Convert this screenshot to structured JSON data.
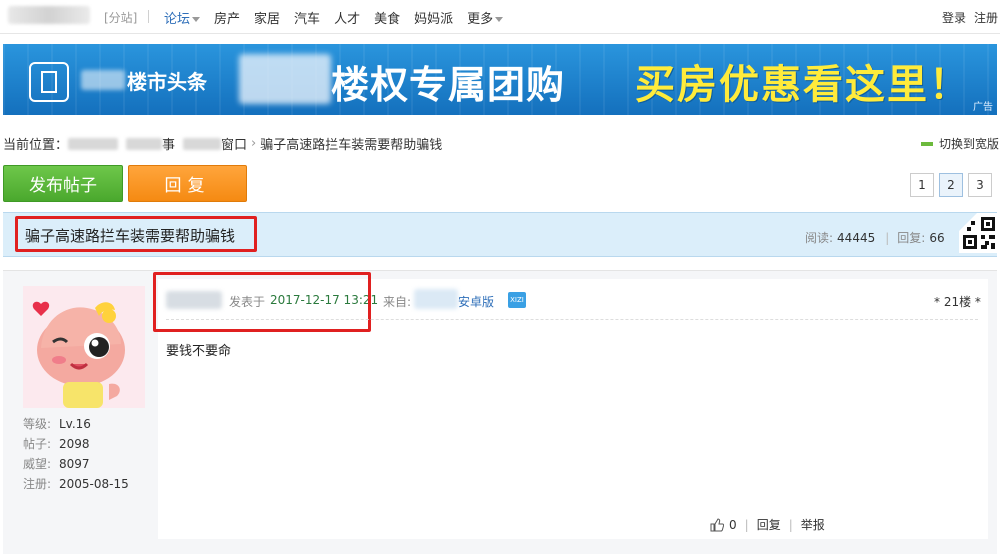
{
  "topnav": {
    "fenzhan": "[分站]",
    "items": [
      {
        "label": "论坛",
        "dropdown": true,
        "active": true
      },
      {
        "label": "房产"
      },
      {
        "label": "家居"
      },
      {
        "label": "汽车"
      },
      {
        "label": "人才"
      },
      {
        "label": "美食"
      },
      {
        "label": "妈妈派"
      },
      {
        "label": "更多",
        "dropdown": true
      }
    ],
    "login": "登录",
    "register": "注册"
  },
  "banner": {
    "brand": "楼市头条",
    "slogan": "楼权专属团购",
    "promo": "买房优惠看这里！",
    "ad_tag": "广告"
  },
  "breadcrumb": {
    "prefix": "当前位置：",
    "part1_tail": "事",
    "part2_tail": "窗口",
    "current": "骗子高速路拦车装需要帮助骗钱",
    "switch_wide": "切换到宽版"
  },
  "actions": {
    "post_label": "发布帖子",
    "reply_label": "回复"
  },
  "pagination": {
    "pages": [
      "1",
      "2",
      "3"
    ],
    "current": "2"
  },
  "thread": {
    "title": "骗子高速路拦车装需要帮助骗钱",
    "views_label": "阅读:",
    "views": "44445",
    "replies_label": "回复:",
    "replies": "66"
  },
  "post": {
    "time_label": "发表于",
    "time": "2017-12-17 13:21",
    "from_label": "来自:",
    "from_app": "安卓版",
    "badge": "XIZI",
    "floor": "* 21楼 *",
    "content": "要钱不要命",
    "like_count": "0",
    "reply_action": "回复",
    "report_action": "举报"
  },
  "user": {
    "level_label": "等级:",
    "level": "Lv.16",
    "posts_label": "帖子:",
    "posts": "2098",
    "prestige_label": "威望:",
    "prestige": "8097",
    "reg_label": "注册:",
    "reg_date": "2005-08-15"
  },
  "colors": {
    "accent_blue": "#2f6fb9",
    "post_green": "#4aa82d",
    "reply_orange": "#f58a12",
    "title_bg": "#dbeefa",
    "highlight_red": "#e02020",
    "banner_yellow": "#ffeb3b"
  }
}
